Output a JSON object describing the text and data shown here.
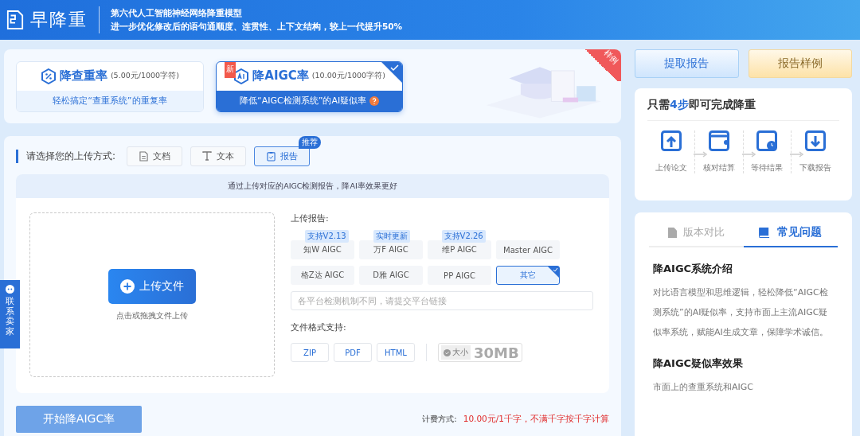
{
  "header": {
    "logo": "早降重",
    "taglines": [
      "第六代人工智能神经网络降重模型",
      "进一步优化修改后的语句通顺度、连贯性、上下文结构，较上一代提升50%"
    ]
  },
  "modes": [
    {
      "title": "降查重率",
      "price": "(5.00元/1000字符)",
      "subtitle": "轻松搞定“查重系统”的重复率",
      "selected": false,
      "kind": "percent"
    },
    {
      "title": "降AIGC率",
      "price": "(10.00元/1000字符)",
      "subtitle": "降低“AIGC检测系统”的AI疑似率",
      "selected": true,
      "kind": "ai",
      "badge": "新"
    }
  ],
  "sample_ribbon": "样例",
  "upload": {
    "label": "请选择您的上传方式:",
    "methods": [
      {
        "label": "文档",
        "kind": "doc",
        "selected": false
      },
      {
        "label": "文本",
        "kind": "text",
        "selected": false
      },
      {
        "label": "报告",
        "kind": "report",
        "selected": true,
        "badge": "推荐"
      }
    ]
  },
  "tip": "通过上传对应的AIGC检测报告，降AI率效果更好",
  "dropzone": {
    "button": "上传文件",
    "hint": "点击或拖拽文件上传"
  },
  "report": {
    "label": "上传报告:",
    "platforms": [
      {
        "label": "知W AIGC",
        "tag": "支持V2.13",
        "selected": false
      },
      {
        "label": "万F AIGC",
        "tag": "实时更新",
        "selected": false
      },
      {
        "label": "维P AIGC",
        "tag": "支持V2.26",
        "selected": false
      },
      {
        "label": "Master AIGC",
        "selected": false
      },
      {
        "label": "格Z达 AIGC",
        "selected": false
      },
      {
        "label": "D雅 AIGC",
        "selected": false
      },
      {
        "label": "PP AIGC",
        "selected": false
      },
      {
        "label": "其它",
        "selected": true
      }
    ],
    "link_placeholder": "各平台检测机制不同，请提交平台链接"
  },
  "formats": {
    "label": "文件格式支持:",
    "items": [
      "ZIP",
      "PDF",
      "HTML"
    ],
    "size_label": "大小",
    "size": "30MB"
  },
  "start_button": "开始降AIGC率",
  "pricing": {
    "label": "计费方式:",
    "value": "10.00元/1千字，不满千字按千字计算"
  },
  "actions": [
    {
      "label": "提取报告",
      "kind": "primary"
    },
    {
      "label": "报告样例",
      "kind": "sample"
    }
  ],
  "steps": {
    "title_before": "只需",
    "title_highlight": "4步",
    "title_after": "即可完成降重",
    "items": [
      {
        "label": "上传论文",
        "kind": "upload"
      },
      {
        "label": "核对结算",
        "kind": "check"
      },
      {
        "label": "等待结果",
        "kind": "wait"
      },
      {
        "label": "下载报告",
        "kind": "download"
      }
    ]
  },
  "faq": {
    "tabs": [
      {
        "label": "版本对比",
        "kind": "file",
        "selected": false
      },
      {
        "label": "常见问题",
        "kind": "book",
        "selected": true
      }
    ],
    "sections": [
      {
        "heading": "降AIGC系统介绍",
        "body": "对比语言模型和思维逻辑，轻松降低“AIGC检测系统”的AI疑似率，支持市面上主流AIGC疑似率系统，赋能AI生成文章，保障学术诚信。"
      },
      {
        "heading": "降AIGC疑似率效果",
        "body": "市面上的查重系统和AIGC"
      }
    ]
  },
  "contact_tab": "联系卖家"
}
